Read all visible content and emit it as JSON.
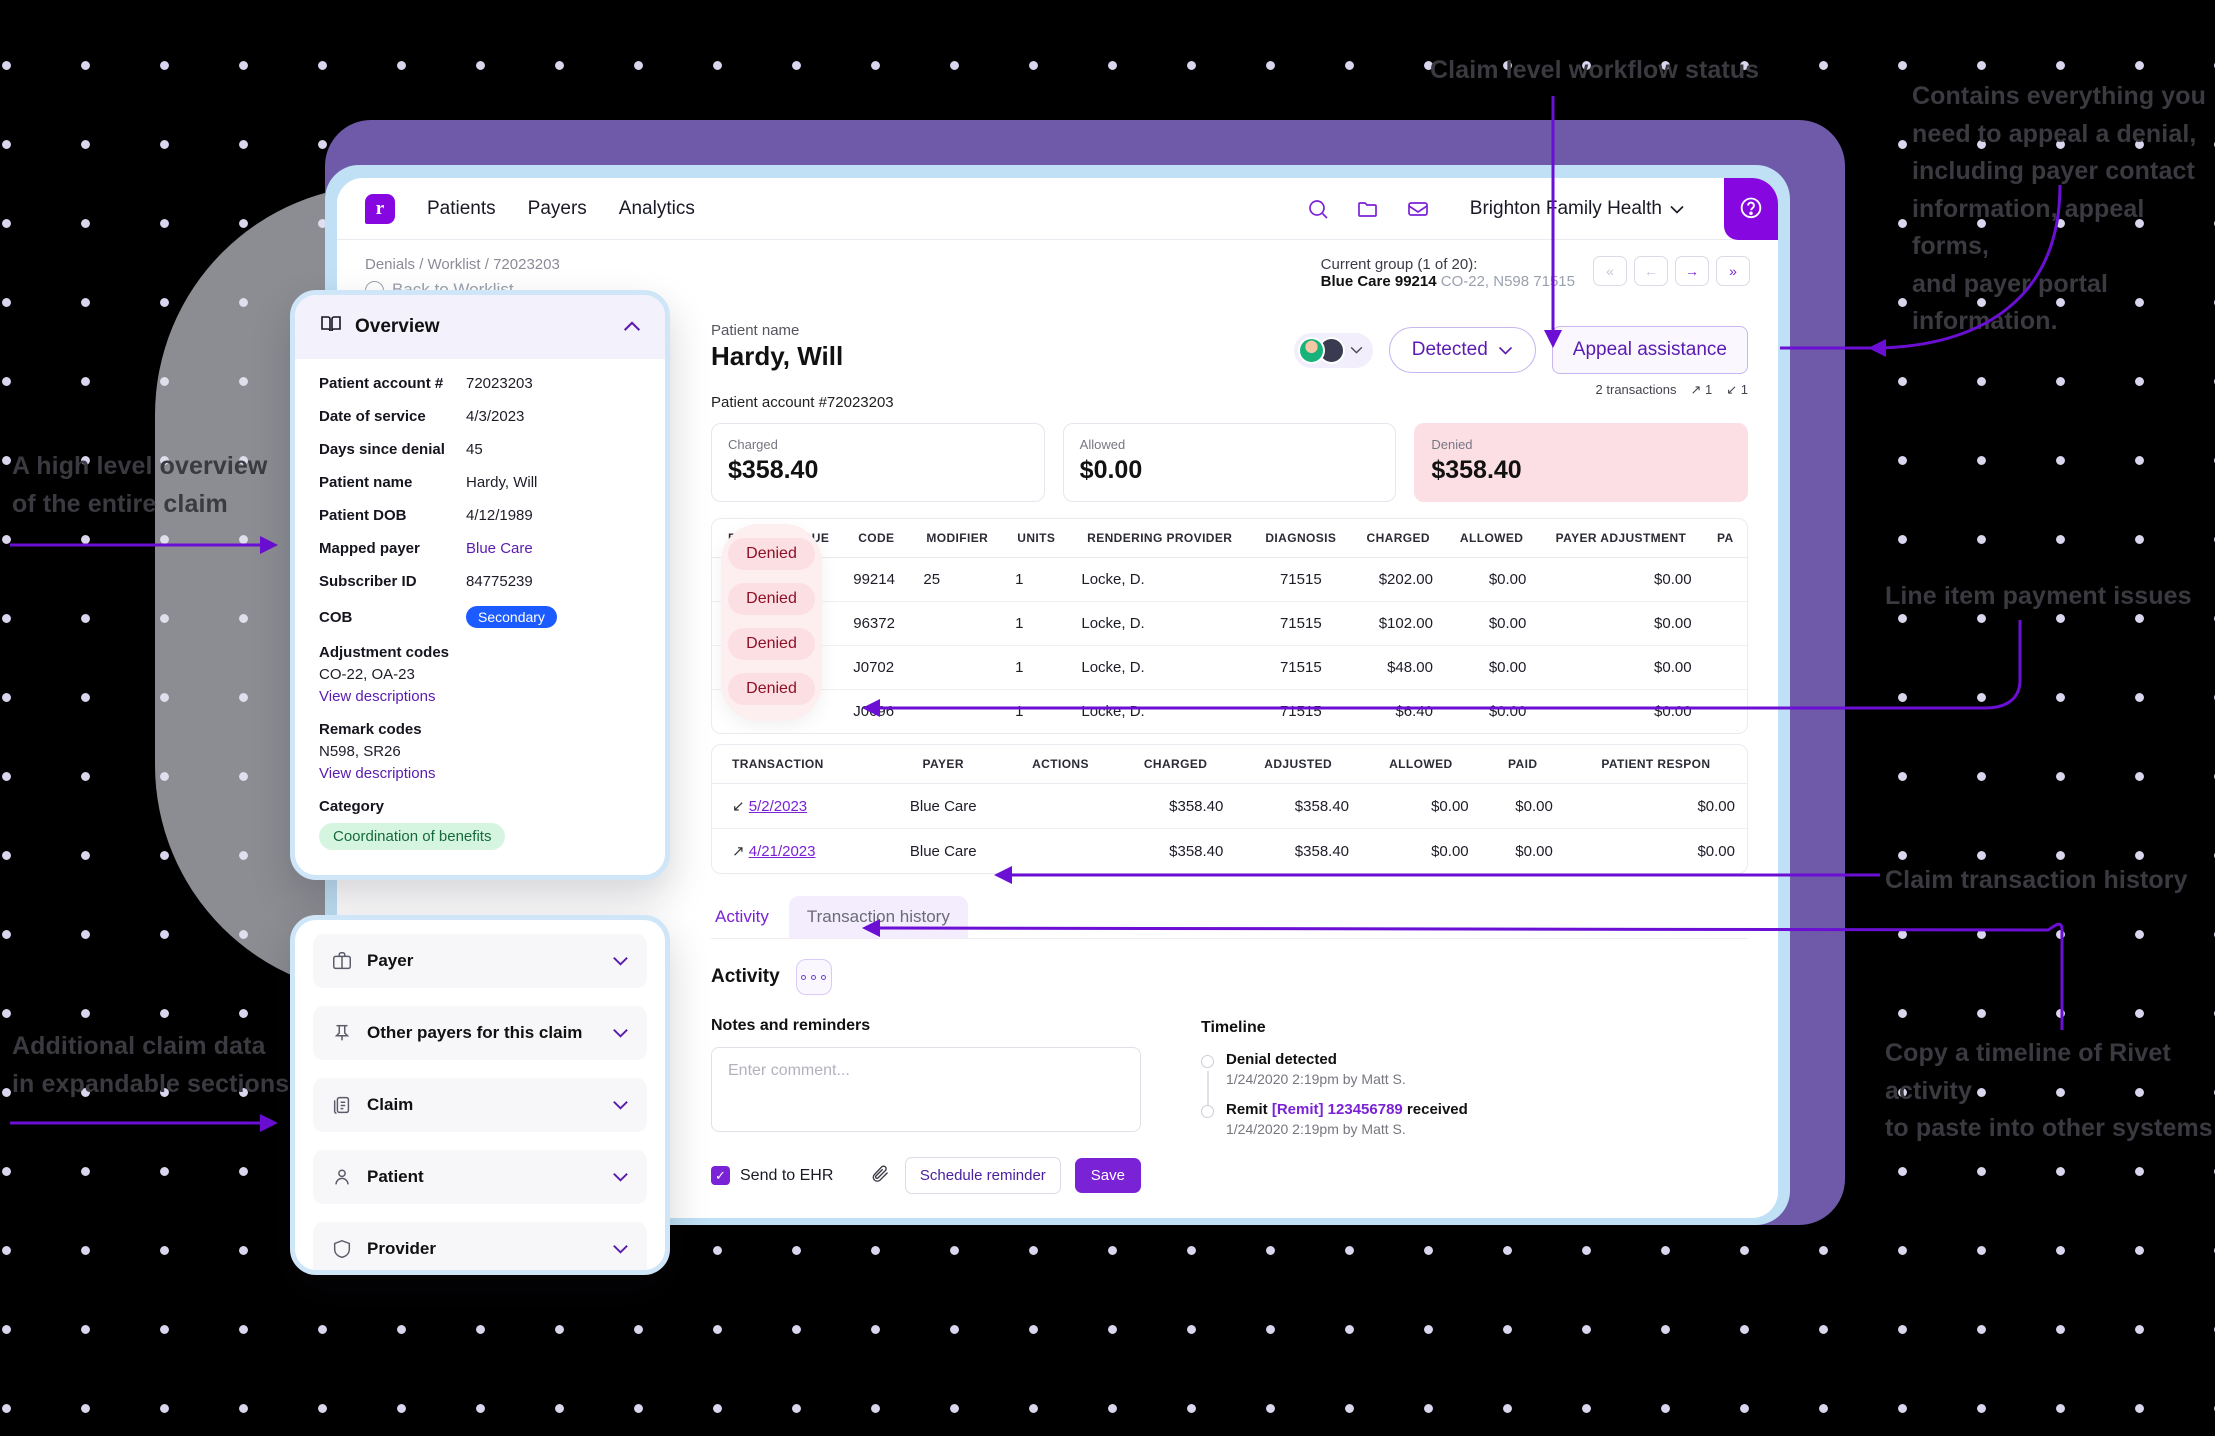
{
  "annotations": {
    "top": "Claim level workflow status",
    "top_right": "Contains everything you\nneed to appeal a denial,\nincluding payer contact\ninformation, appeal forms,\nand payer portal information.",
    "left_top": "A high level overview\nof the entire claim",
    "left_bottom": "Additional claim data\nin expandable sections",
    "right_mid": "Line item payment issues",
    "right_lower": "Claim transaction history",
    "right_bottom": "Copy a timeline of Rivet activity\nto paste into other systems"
  },
  "topnav": {
    "logo_text": "r",
    "links": [
      "Patients",
      "Payers",
      "Analytics"
    ],
    "icons": [
      "search-icon",
      "folder-icon",
      "inbox-icon"
    ],
    "org": "Brighton Family Health",
    "help": "?"
  },
  "breadcrumb": {
    "path": "Denials / Worklist / 72023203",
    "back": "Back to Worklist"
  },
  "group": {
    "line1": "Current group (1 of 20):",
    "payer": "Blue Care 99214",
    "codes": "CO-22, N598 71515",
    "pager": [
      "«",
      "←",
      "→",
      "»"
    ]
  },
  "overview": {
    "title": "Overview",
    "rows": [
      {
        "key": "Patient account #",
        "value": "72023203",
        "type": "text"
      },
      {
        "key": "Date of service",
        "value": "4/3/2023",
        "type": "text"
      },
      {
        "key": "Days since denial",
        "value": "45",
        "type": "text"
      },
      {
        "key": "Patient name",
        "value": "Hardy, Will",
        "type": "text"
      },
      {
        "key": "Patient DOB",
        "value": "4/12/1989",
        "type": "text"
      },
      {
        "key": "Mapped payer",
        "value": "Blue Care",
        "type": "link"
      },
      {
        "key": "Subscriber ID",
        "value": "84775239",
        "type": "text"
      },
      {
        "key": "COB",
        "value": "Secondary",
        "type": "badge"
      }
    ],
    "adjustment_title": "Adjustment codes",
    "adjustment_value": "CO-22, OA-23",
    "adjustment_link": "View descriptions",
    "remark_title": "Remark codes",
    "remark_value": "N598, SR26",
    "remark_link": "View descriptions",
    "category_title": "Category",
    "category_value": "Coordination of benefits"
  },
  "sections": [
    {
      "label": "Payer",
      "icon": "briefcase-icon"
    },
    {
      "label": "Other payers for this claim",
      "icon": "pin-icon"
    },
    {
      "label": "Claim",
      "icon": "documents-icon"
    },
    {
      "label": "Patient",
      "icon": "person-icon"
    },
    {
      "label": "Provider",
      "icon": "shield-icon"
    }
  ],
  "patient": {
    "name_label": "Patient name",
    "name": "Hardy, Will",
    "account": "Patient account #72023203",
    "status_button": "Detected",
    "appeal_button": "Appeal assistance",
    "transactions_count": "2 transactions",
    "tx_up": "1",
    "tx_down": "1"
  },
  "stats": [
    {
      "label": "Charged",
      "value": "$358.40",
      "denied": false
    },
    {
      "label": "Allowed",
      "value": "$0.00",
      "denied": false
    },
    {
      "label": "Denied",
      "value": "$358.40",
      "denied": true
    }
  ],
  "lineitems": {
    "headers": [
      "PAYMENT ISSUE",
      "CODE",
      "MODIFIER",
      "UNITS",
      "RENDERING PROVIDER",
      "DIAGNOSIS",
      "CHARGED",
      "ALLOWED",
      "PAYER ADJUSTMENT",
      "PA"
    ],
    "issue_label": "Denied",
    "rows": [
      {
        "code": "99214",
        "modifier": "25",
        "units": "1",
        "provider": "Locke, D.",
        "diagnosis": "71515",
        "charged": "$202.00",
        "allowed": "$0.00",
        "payer_adjustment": "$0.00"
      },
      {
        "code": "96372",
        "modifier": "",
        "units": "1",
        "provider": "Locke, D.",
        "diagnosis": "71515",
        "charged": "$102.00",
        "allowed": "$0.00",
        "payer_adjustment": "$0.00"
      },
      {
        "code": "J0702",
        "modifier": "",
        "units": "1",
        "provider": "Locke, D.",
        "diagnosis": "71515",
        "charged": "$48.00",
        "allowed": "$0.00",
        "payer_adjustment": "$0.00"
      },
      {
        "code": "J0696",
        "modifier": "",
        "units": "1",
        "provider": "Locke, D.",
        "diagnosis": "71515",
        "charged": "$6.40",
        "allowed": "$0.00",
        "payer_adjustment": "$0.00"
      }
    ]
  },
  "transactions": {
    "headers": [
      "TRANSACTION",
      "PAYER",
      "ACTIONS",
      "CHARGED",
      "ADJUSTED",
      "ALLOWED",
      "PAID",
      "PATIENT RESPON"
    ],
    "rows": [
      {
        "date": "5/2/2023",
        "dir": "in",
        "payer": "Blue Care",
        "charged": "$358.40",
        "adjusted": "$358.40",
        "allowed": "$0.00",
        "paid": "$0.00",
        "patient": "$0.00"
      },
      {
        "date": "4/21/2023",
        "dir": "out",
        "payer": "Blue Care",
        "charged": "$358.40",
        "adjusted": "$358.40",
        "allowed": "$0.00",
        "paid": "$0.00",
        "patient": "$0.00"
      }
    ]
  },
  "tabs": {
    "activity": "Activity",
    "transaction_history": "Transaction history"
  },
  "activity": {
    "title": "Activity",
    "notes_title": "Notes and reminders",
    "comment_placeholder": "Enter comment...",
    "comment_value": "",
    "send_to_ehr": "Send to EHR",
    "schedule_reminder": "Schedule reminder",
    "save": "Save"
  },
  "timeline": {
    "title": "Timeline",
    "items": [
      {
        "title": "Denial detected",
        "sub": "1/24/2020 2:19pm by Matt S.",
        "link": "",
        "after": ""
      },
      {
        "title": "Remit ",
        "link": "[Remit] 123456789",
        "after": " received",
        "sub": "1/24/2020 2:19pm by Matt S."
      }
    ]
  },
  "colors": {
    "brand": "#7a22d6",
    "denied_bg": "#fcdfe4",
    "badge_blue": "#1c5bff",
    "chip_green": "#d6f5e0"
  }
}
